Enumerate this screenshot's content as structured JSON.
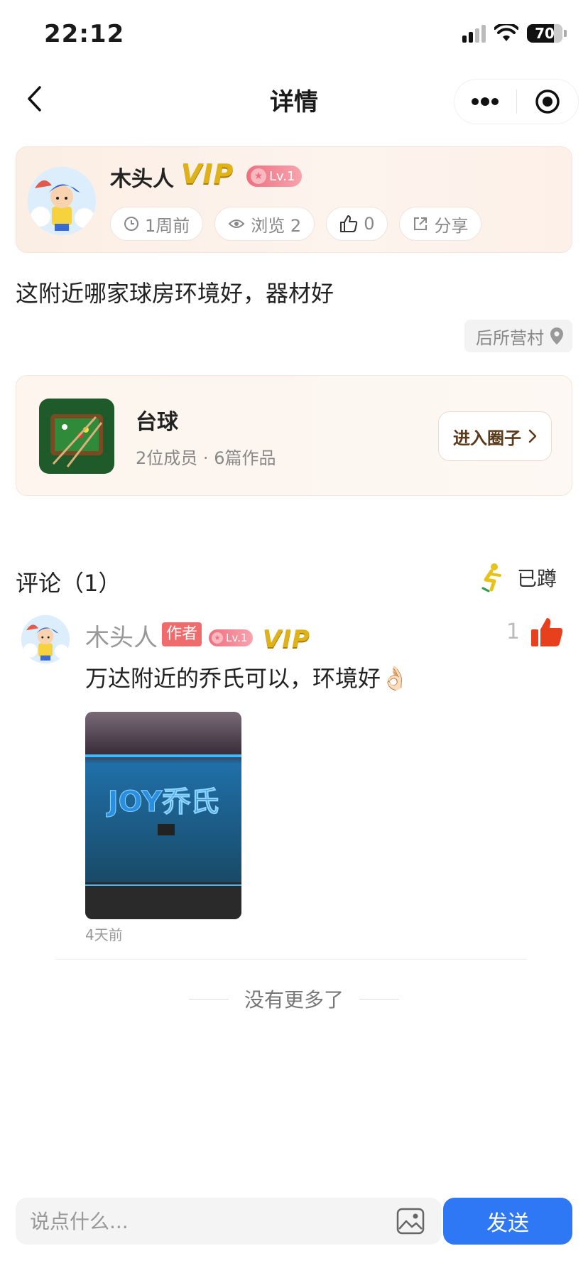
{
  "status_bar": {
    "time": "22:12",
    "battery": "70"
  },
  "nav": {
    "title": "详情"
  },
  "author": {
    "name": "木头人",
    "vip": "VIP",
    "level": "Lv.1",
    "time_ago": "1周前",
    "views": "浏览 2",
    "likes": "0",
    "share": "分享"
  },
  "post": {
    "text": "这附近哪家球房环境好，器材好",
    "location": "后所营村"
  },
  "circle": {
    "name": "台球",
    "members": "2位成员",
    "works": "6篇作品",
    "enter_label": "进入圈子"
  },
  "comments": {
    "header": "评论（1）",
    "squat_label": "已蹲",
    "items": [
      {
        "name": "木头人",
        "author_tag": "作者",
        "level": "Lv.1",
        "vip": "VIP",
        "likes": "1",
        "text": "万达附近的乔氏可以，环境好👌🏻",
        "image_sign_text": "JOY乔氏",
        "time": "4天前"
      }
    ]
  },
  "footer": {
    "no_more": "没有更多了"
  },
  "input": {
    "placeholder": "说点什么...",
    "send_label": "发送"
  },
  "colors": {
    "accent": "#2e78f6",
    "like": "#e8401c",
    "author_tag": "#f06b6b",
    "vip_gold": "#e0b21a"
  }
}
